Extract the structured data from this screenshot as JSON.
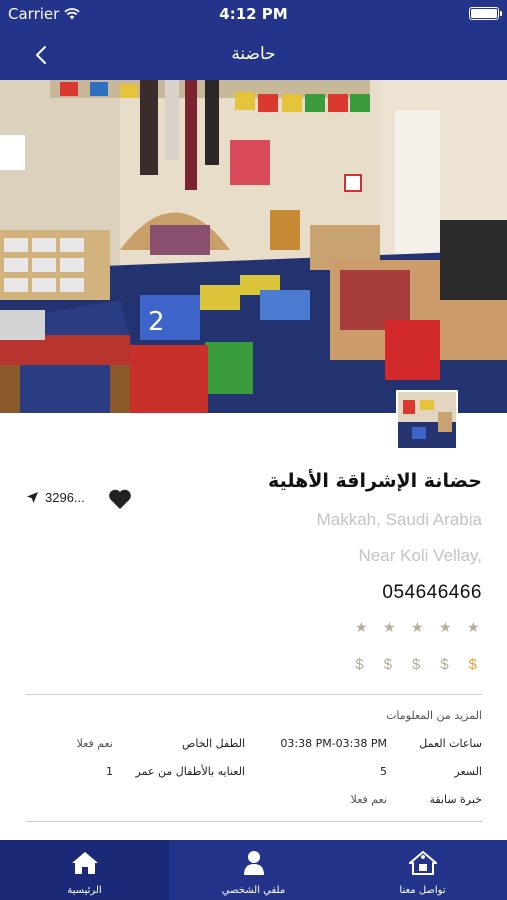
{
  "status_bar": {
    "carrier": "Carrier",
    "time": "4:12 PM"
  },
  "nav": {
    "title": "حاضنة"
  },
  "nursery": {
    "name": "حضانة الإشراقة الأهلية",
    "location": "Makkah, Saudi Arabia",
    "address": "Near Koli Vellay,",
    "phone": "054646466",
    "distance": "3296...",
    "rating": 0,
    "rating_max": 5,
    "price_level": 1,
    "price_symbol": "$"
  },
  "more_info": {
    "title": "المزيد من المعلومات",
    "working_hours_label": "ساعات العمل",
    "working_hours_value": "03:38 PM-03:38 PM",
    "special_child_label": "الطفل الخاص",
    "special_child_value": "نعم فعلا",
    "price_label": "السعر",
    "price_value": "5",
    "care_age_label": "العنايه بالأطفال من عمر",
    "care_age_value": "1",
    "experience_label": "خبرة سابقة",
    "experience_value": "نعم فعلا"
  },
  "tabs": [
    {
      "label": "الرئيسية",
      "icon": "home-icon"
    },
    {
      "label": "ملفي الشخصي",
      "icon": "profile-icon"
    },
    {
      "label": "تواصل معنا",
      "icon": "contact-house-icon"
    }
  ],
  "colors": {
    "primary": "#23348a",
    "star_inactive": "#b5ad98",
    "price_active": "#e3a23a",
    "muted_text": "#c4c4c4"
  }
}
